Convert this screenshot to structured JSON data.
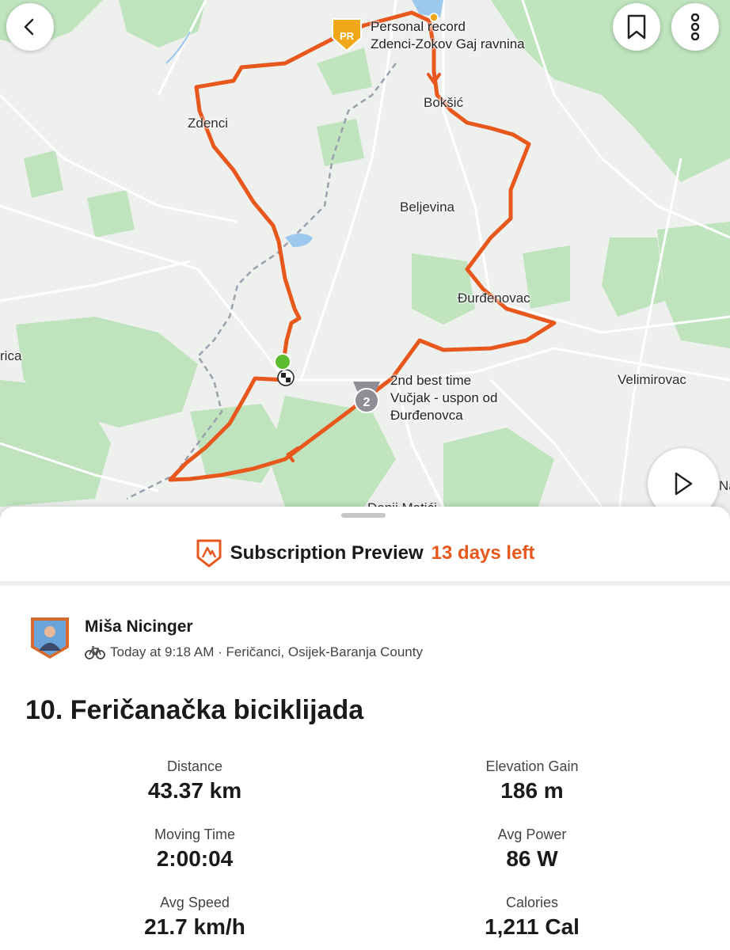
{
  "map": {
    "places": [
      "Zdenci",
      "Bokšić",
      "Beljevina",
      "Đurđenovac",
      "Velimirovac",
      "rica",
      "Na",
      "Donji Matići"
    ],
    "personal_record": {
      "badge": "PR",
      "line1": "Personal record",
      "line2": "Zdenci-Zokov Gaj ravnina"
    },
    "second_best": {
      "badge": "2",
      "line1": "2nd best time",
      "line2": "Vučjak - uspon od",
      "line3": "Đurđenovca"
    },
    "route_color": "#e8571c",
    "start_color": "#5dbb2f"
  },
  "nav": {
    "back_icon": "chevron-left-icon",
    "bookmark_icon": "bookmark-icon",
    "more_icon": "more-vertical-icon",
    "play_icon": "play-icon"
  },
  "subscription": {
    "label": "Subscription Preview",
    "days_left": "13 days left",
    "accent": "#e8571c"
  },
  "activity": {
    "athlete": "Miša Nicinger",
    "meta": "Today at 9:18 AM · Feričanci, Osijek-Baranja County",
    "title": "10. Feričanačka biciklijada"
  },
  "stats": [
    {
      "label": "Distance",
      "value": "43.37 km"
    },
    {
      "label": "Elevation Gain",
      "value": "186 m"
    },
    {
      "label": "Moving Time",
      "value": "2:00:04"
    },
    {
      "label": "Avg Power",
      "value": "86 W"
    },
    {
      "label": "Avg Speed",
      "value": "21.7 km/h"
    },
    {
      "label": "Calories",
      "value": "1,211 Cal"
    }
  ]
}
